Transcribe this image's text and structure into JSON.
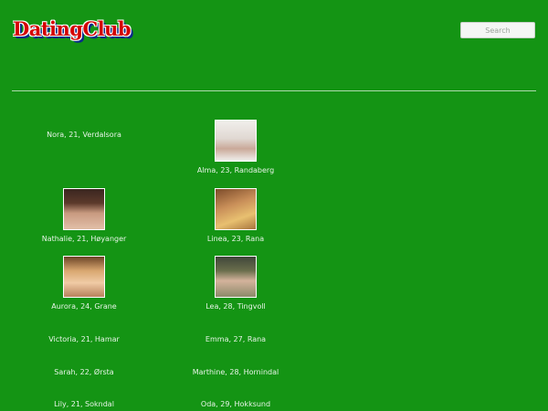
{
  "header": {
    "logo_text": "DatingClub",
    "search_placeholder": "Search"
  },
  "profiles": [
    {
      "caption": "Nora, 21, Verdalsora",
      "has_photo": false,
      "photo": ""
    },
    {
      "caption": "Alma, 23, Randaberg",
      "has_photo": true,
      "photo": "studio"
    },
    {
      "caption": "Nathalie, 21, Høyanger",
      "has_photo": true,
      "photo": "hair-dark"
    },
    {
      "caption": "Linea, 23, Rana",
      "has_photo": true,
      "photo": "warm"
    },
    {
      "caption": "Aurora, 24, Grane",
      "has_photo": true,
      "photo": "blonde"
    },
    {
      "caption": "Lea, 28, Tingvoll",
      "has_photo": true,
      "photo": "room"
    },
    {
      "caption": "Victoria, 21, Hamar",
      "has_photo": false,
      "photo": ""
    },
    {
      "caption": "Emma, 27, Rana",
      "has_photo": false,
      "photo": ""
    },
    {
      "caption": "Sarah, 22, Ørsta",
      "has_photo": false,
      "photo": ""
    },
    {
      "caption": "Marthine, 28, Hornindal",
      "has_photo": false,
      "photo": ""
    },
    {
      "caption": "Lily, 21, Sokndal",
      "has_photo": false,
      "photo": ""
    },
    {
      "caption": "Oda, 29, Hokksund",
      "has_photo": false,
      "photo": ""
    }
  ],
  "colors": {
    "background": "#149414",
    "logo_red": "#d40000",
    "logo_shadow_blue": "#0b2a8a"
  }
}
